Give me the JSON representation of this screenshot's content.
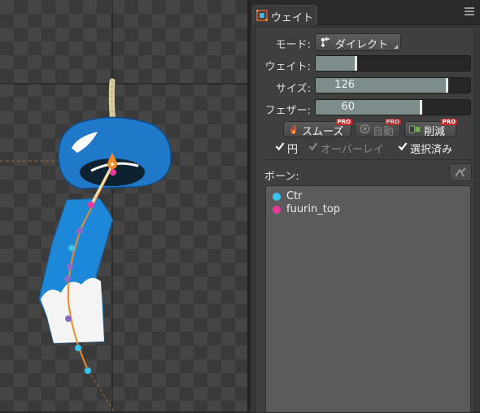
{
  "tab": {
    "title": "ウェイト",
    "icon": "weight-panel-icon"
  },
  "mode": {
    "label": "モード:",
    "value": "ダイレクト",
    "icon": "direct-mode-icon"
  },
  "weight": {
    "label": "ウェイト:",
    "level": 0.27
  },
  "size": {
    "label": "サイズ:",
    "value": "126",
    "level": 0.86
  },
  "feather": {
    "label": "フェザー:",
    "value": "60",
    "level": 0.69
  },
  "buttons": {
    "smooth": "スムーズ",
    "auto": "自動",
    "reduce": "削減",
    "pro_badge": "PRO"
  },
  "options": {
    "circle": {
      "label": "円",
      "checked": true
    },
    "overlay": {
      "label": "オーバーレイ",
      "checked": true,
      "enabled": false
    },
    "selected_only": {
      "label": "選択済み",
      "checked": true
    }
  },
  "bones": {
    "label": "ボーン:",
    "items": [
      {
        "name": "Ctr",
        "color": "#36c5f0"
      },
      {
        "name": "fuurin_top",
        "color": "#e8389e"
      }
    ]
  },
  "colors": {
    "accent_orange": "#f08a24",
    "bone_cyan": "#36c5f0",
    "bone_magenta": "#e8389e",
    "pro_red": "#c62828"
  }
}
